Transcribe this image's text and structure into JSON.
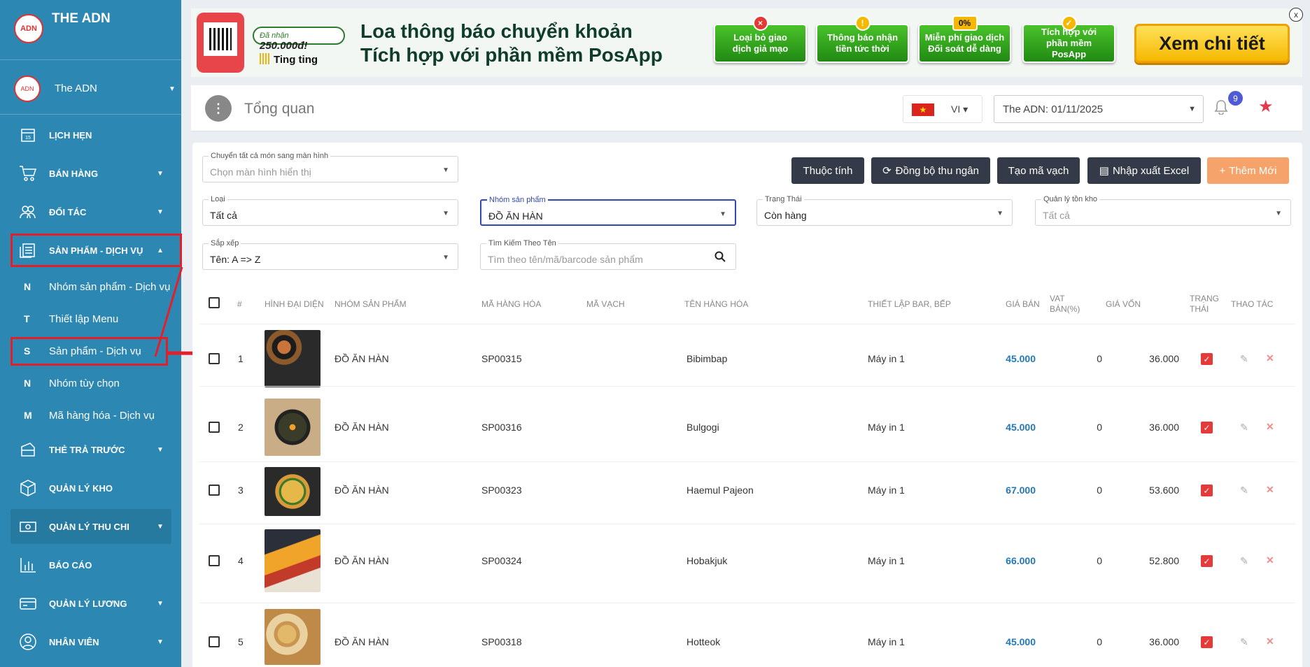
{
  "sidebar": {
    "brand_title": "THE ADN",
    "logo_text": "ADN",
    "user_name": "The ADN",
    "menu": [
      {
        "label": "LỊCH HẸN"
      },
      {
        "label": "BÁN HÀNG"
      },
      {
        "label": "ĐỐI TÁC"
      },
      {
        "label": "SẢN PHẨM - DỊCH VỤ"
      },
      {
        "label": "THẺ TRẢ TRƯỚC"
      },
      {
        "label": "QUẢN LÝ KHO"
      },
      {
        "label": "QUẢN LÝ THU CHI"
      },
      {
        "label": "BÁO CÁO"
      },
      {
        "label": "QUẢN LÝ LƯƠNG"
      },
      {
        "label": "NHÂN VIÊN"
      }
    ],
    "calendar_day": "15",
    "submenu": [
      {
        "letter": "N",
        "label": "Nhóm sản phẩm - Dịch vụ"
      },
      {
        "letter": "T",
        "label": "Thiết lập Menu"
      },
      {
        "letter": "S",
        "label": "Sản phẩm - Dịch vụ"
      },
      {
        "letter": "N",
        "label": "Nhóm tùy chọn"
      },
      {
        "letter": "M",
        "label": "Mã hàng hóa - Dịch vụ"
      }
    ]
  },
  "banner": {
    "pill_prefix": "Đã nhận",
    "pill_amount": "250.000đ!",
    "ting": "Ting ting",
    "headline_1": "Loa thông báo chuyển khoản",
    "headline_2": "Tích hợp với phần mềm PosApp",
    "features": [
      {
        "line1": "Loại bỏ giao",
        "line2": "dịch giả mạo",
        "badge": "×"
      },
      {
        "line1": "Thông báo nhận",
        "line2": "tiền tức thời",
        "badge": "!"
      },
      {
        "line1": "Miễn phí giao dịch",
        "line2": "Đối soát dễ dàng",
        "badge": "0%"
      },
      {
        "line1": "Tích hợp với",
        "line2": "phần mềm PosApp",
        "badge": "✓"
      }
    ],
    "cta": "Xem chi tiết",
    "close": "x"
  },
  "header": {
    "title": "Tổng quan",
    "lang": "VI",
    "store": "The ADN: 01/11/2025",
    "notif_count": "9"
  },
  "toolbar": {
    "screen_label": "Chuyển tất cả món sang màn hình",
    "screen_placeholder": "Chọn màn hình hiển thị",
    "buttons": {
      "attributes": "Thuộc tính",
      "sync": "Đồng bộ thu ngân",
      "barcode": "Tạo mã vạch",
      "excel": "Nhập xuất Excel",
      "add": "Thêm Mới"
    }
  },
  "filters": {
    "type": {
      "label": "Loại",
      "value": "Tất cả"
    },
    "group": {
      "label": "Nhóm sản phẩm",
      "value": "ĐỒ ĂN HÀN"
    },
    "status": {
      "label": "Trạng Thái",
      "value": "Còn hàng"
    },
    "stock": {
      "label": "Quản lý tồn kho",
      "value": "Tất cả"
    },
    "sort": {
      "label": "Sắp xếp",
      "value": "Tên: A => Z"
    },
    "search": {
      "label": "Tìm Kiếm Theo Tên",
      "placeholder": "Tìm theo tên/mã/barcode sản phẩm"
    }
  },
  "table": {
    "headers": {
      "num": "#",
      "image": "HÌNH ĐẠI DIỆN",
      "group": "NHÓM SẢN PHẨM",
      "code": "MÃ HÀNG HÓA",
      "barcode": "MÃ VẠCH",
      "name": "TÊN HÀNG HÓA",
      "bar": "THIẾT LẬP BAR, BẾP",
      "price": "GIÁ BÁN",
      "vat1": "VAT",
      "vat2": "BÁN(%)",
      "cost": "GIÁ VỐN",
      "status1": "TRẠNG",
      "status2": "THÁI",
      "actions": "THAO TÁC"
    },
    "rows": [
      {
        "num": "1",
        "group": "ĐỒ ĂN HÀN",
        "code": "SP00315",
        "name": "Bibimbap",
        "bar": "Máy in 1",
        "price": "45.000",
        "vat": "0",
        "cost": "36.000"
      },
      {
        "num": "2",
        "group": "ĐỒ ĂN HÀN",
        "code": "SP00316",
        "name": "Bulgogi",
        "bar": "Máy in 1",
        "price": "45.000",
        "vat": "0",
        "cost": "36.000"
      },
      {
        "num": "3",
        "group": "ĐỒ ĂN HÀN",
        "code": "SP00323",
        "name": "Haemul Pajeon",
        "bar": "Máy in 1",
        "price": "67.000",
        "vat": "0",
        "cost": "53.600"
      },
      {
        "num": "4",
        "group": "ĐỒ ĂN HÀN",
        "code": "SP00324",
        "name": "Hobakjuk",
        "bar": "Máy in 1",
        "price": "66.000",
        "vat": "0",
        "cost": "52.800"
      },
      {
        "num": "5",
        "group": "ĐỒ ĂN HÀN",
        "code": "SP00318",
        "name": "Hotteok",
        "bar": "Máy in 1",
        "price": "45.000",
        "vat": "0",
        "cost": "36.000"
      }
    ]
  },
  "colors": {
    "sidebar": "#2c87b3",
    "accent_red": "#e3202a",
    "price_blue": "#2378b5",
    "add_button": "#f5a36b"
  }
}
